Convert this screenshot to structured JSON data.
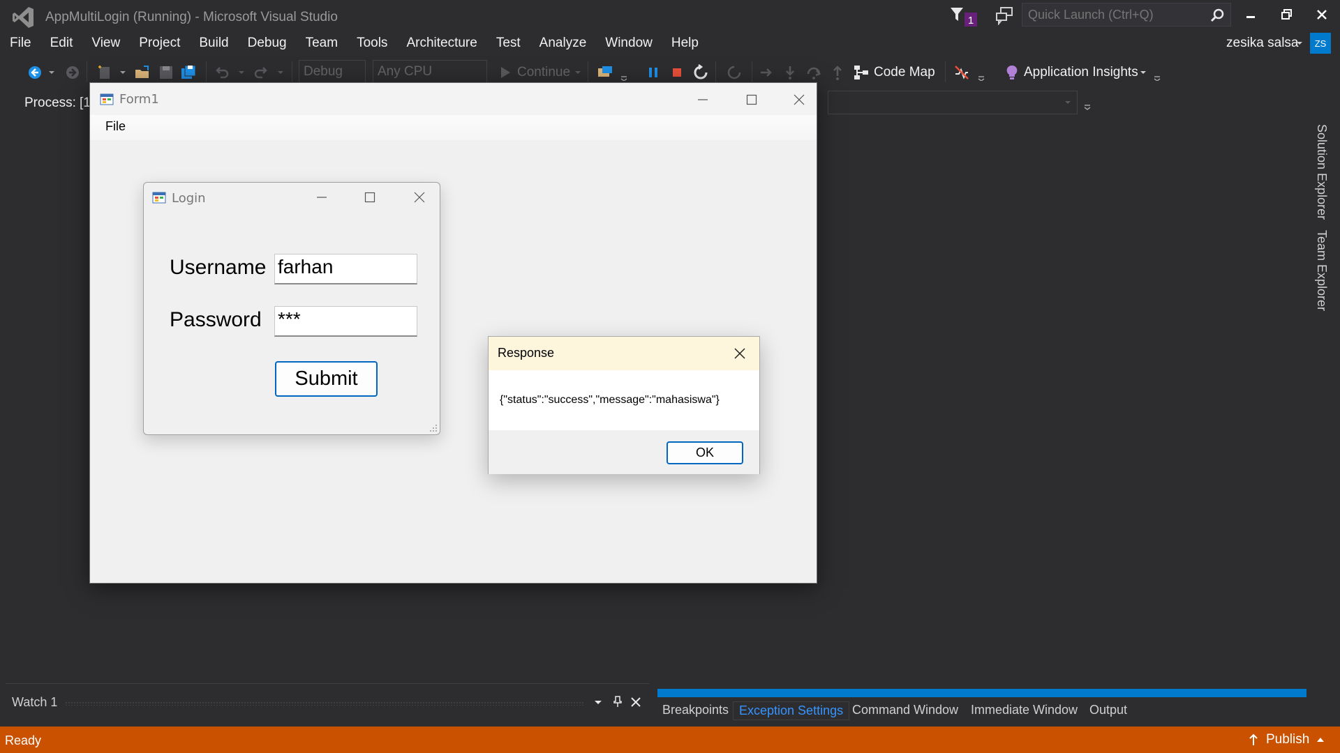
{
  "window": {
    "title": "AppMultiLogin (Running) - Microsoft Visual Studio",
    "notification_count": "1",
    "quick_launch_placeholder": "Quick Launch (Ctrl+Q)"
  },
  "menu": [
    "File",
    "Edit",
    "View",
    "Project",
    "Build",
    "Debug",
    "Team",
    "Tools",
    "Architecture",
    "Test",
    "Analyze",
    "Window",
    "Help"
  ],
  "user": {
    "name": "zesika salsa",
    "initials": "ZS"
  },
  "toolbar": {
    "config": "Debug",
    "platform": "Any CPU",
    "continue_label": "Continue",
    "code_map_label": "Code Map",
    "app_insights_label": "Application Insights",
    "process_label": "Process:",
    "process_value": "[1"
  },
  "side_tabs": [
    "Solution Explorer",
    "Team Explorer"
  ],
  "form1": {
    "title": "Form1",
    "menu_file": "File"
  },
  "login": {
    "title": "Login",
    "username_label": "Username",
    "username_value": "farhan",
    "password_label": "Password",
    "password_value": "***",
    "submit_label": "Submit"
  },
  "response": {
    "title": "Response",
    "message": "{\"status\":\"success\",\"message\":\"mahasiswa\"}",
    "ok_label": "OK"
  },
  "watch": {
    "title": "Watch 1"
  },
  "bottom_tabs": [
    "Breakpoints",
    "Exception Settings",
    "Command Window",
    "Immediate Window",
    "Output"
  ],
  "status": {
    "text": "Ready",
    "publish_label": "Publish"
  },
  "colors": {
    "accent": "#007acc",
    "status_bar": "#ca5100",
    "background": "#2d2d30"
  }
}
